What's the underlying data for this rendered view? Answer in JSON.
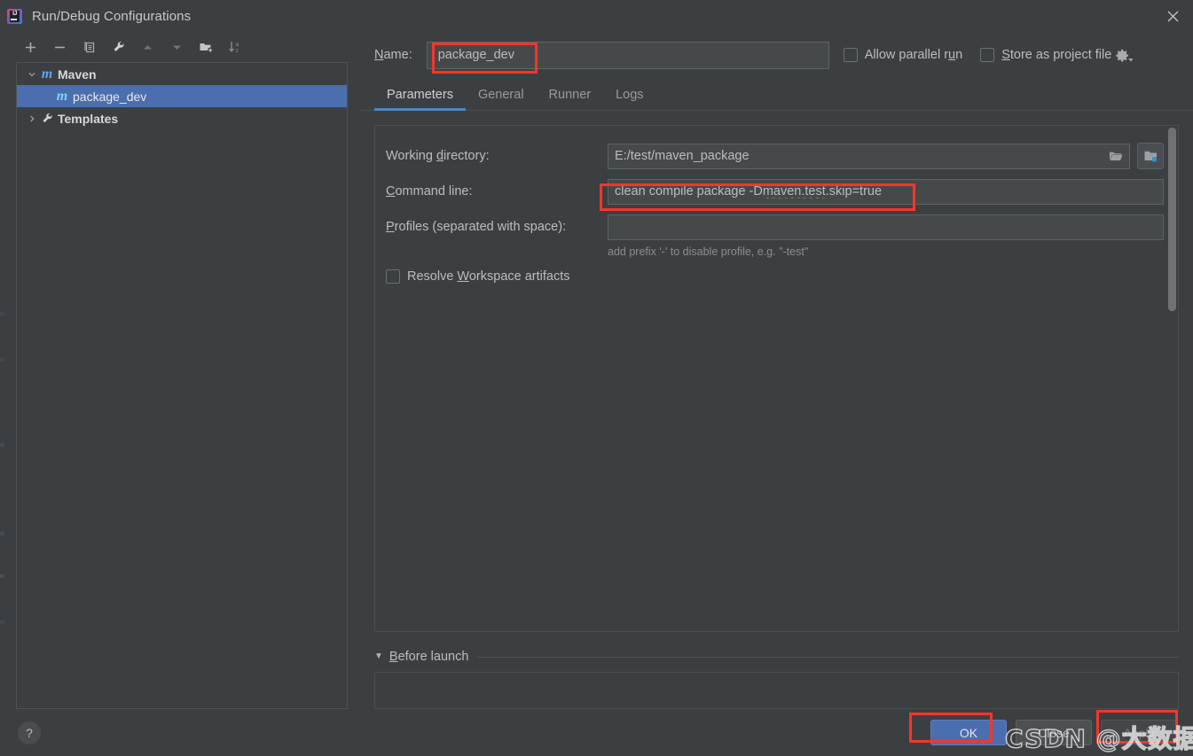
{
  "window": {
    "title": "Run/Debug Configurations",
    "app_icon": "intellij-idea-icon",
    "close_icon": "close-icon"
  },
  "toolbar": {
    "buttons": [
      {
        "name": "add-configuration-button",
        "icon": "plus-icon",
        "tooltip": "Add New Configuration"
      },
      {
        "name": "remove-configuration-button",
        "icon": "minus-icon",
        "tooltip": "Remove Configuration"
      },
      {
        "name": "copy-configuration-button",
        "icon": "copy-icon",
        "tooltip": "Copy Configuration"
      },
      {
        "name": "edit-templates-button",
        "icon": "wrench-icon",
        "tooltip": "Edit Templates"
      },
      {
        "name": "move-up-button",
        "icon": "arrow-up-icon",
        "tooltip": "Move Up"
      },
      {
        "name": "move-down-button",
        "icon": "arrow-down-icon",
        "tooltip": "Move Down"
      },
      {
        "name": "new-folder-button",
        "icon": "new-folder-icon",
        "tooltip": "Create New Folder"
      },
      {
        "name": "sort-configurations-button",
        "icon": "sort-az-icon",
        "tooltip": "Sort Configurations"
      }
    ]
  },
  "tree": {
    "items": [
      {
        "label": "Maven",
        "icon": "maven-m-icon",
        "twisty": "expanded",
        "level": 0,
        "selected": false,
        "bold": true
      },
      {
        "label": "package_dev",
        "icon": "maven-m-icon",
        "twisty": "none",
        "level": 1,
        "selected": true,
        "bold": false
      },
      {
        "label": "Templates",
        "icon": "wrench-icon",
        "twisty": "collapsed",
        "level": 0,
        "selected": false,
        "bold": true
      }
    ]
  },
  "help": {
    "label": "?",
    "name": "help-button"
  },
  "form": {
    "name_label": "Name:",
    "name_label_mnemonic": "N",
    "name_value": "package_dev",
    "allow_parallel_run": {
      "label_before": "Allow parallel r",
      "label_mnemonic": "u",
      "label_after": "n",
      "checked": false
    },
    "store_as_project_file": {
      "label_mnemonic": "S",
      "label_after": "tore as project file",
      "checked": false
    },
    "gear_icon": "gear-dropdown-icon"
  },
  "tabs": [
    {
      "label": "Parameters",
      "active": true
    },
    {
      "label": "General",
      "active": false
    },
    {
      "label": "Runner",
      "active": false
    },
    {
      "label": "Logs",
      "active": false
    }
  ],
  "parameters": {
    "working_directory": {
      "label_before": "Working ",
      "label_mnemonic": "d",
      "label_after": "irectory:",
      "value": "E:/test/maven_package",
      "browse_icon": "folder-open-icon",
      "module_icon": "module-folder-icon"
    },
    "command_line": {
      "label_mnemonic": "C",
      "label_after": "ommand line:",
      "value_plain": "clean compile package -D",
      "value_squiggly": "maven.test",
      "value_tail": ".skip=true",
      "value_full": "clean compile package -Dmaven.test.skip=true"
    },
    "profiles": {
      "label_mnemonic": "P",
      "label_after": "rofiles (separated with space):",
      "value": "",
      "hint": "add prefix '-' to disable profile, e.g. \"-test\""
    },
    "resolve_workspace_artifacts": {
      "label_before": "Resolve ",
      "label_mnemonic": "W",
      "label_after": "orkspace artifacts",
      "checked": false
    }
  },
  "before_launch": {
    "arrow": "triangle-down-icon",
    "label_mnemonic": "B",
    "label_after": "efore launch",
    "items": []
  },
  "buttons": {
    "ok": "OK",
    "close": "Close",
    "apply": "Apply"
  },
  "watermark": {
    "text": "CSDN @大数据_小袁"
  },
  "colors": {
    "background": "#3c3f41",
    "field_background": "#45494a",
    "selection_blue": "#4b6eaf",
    "accent_blue": "#4a88c7",
    "maven_icon_blue": "#56a8f5",
    "annotation_red": "#f5352b",
    "text": "#bcbcbc",
    "hint_text": "#8c8c8c",
    "squiggle_green": "#5a8a4a"
  }
}
